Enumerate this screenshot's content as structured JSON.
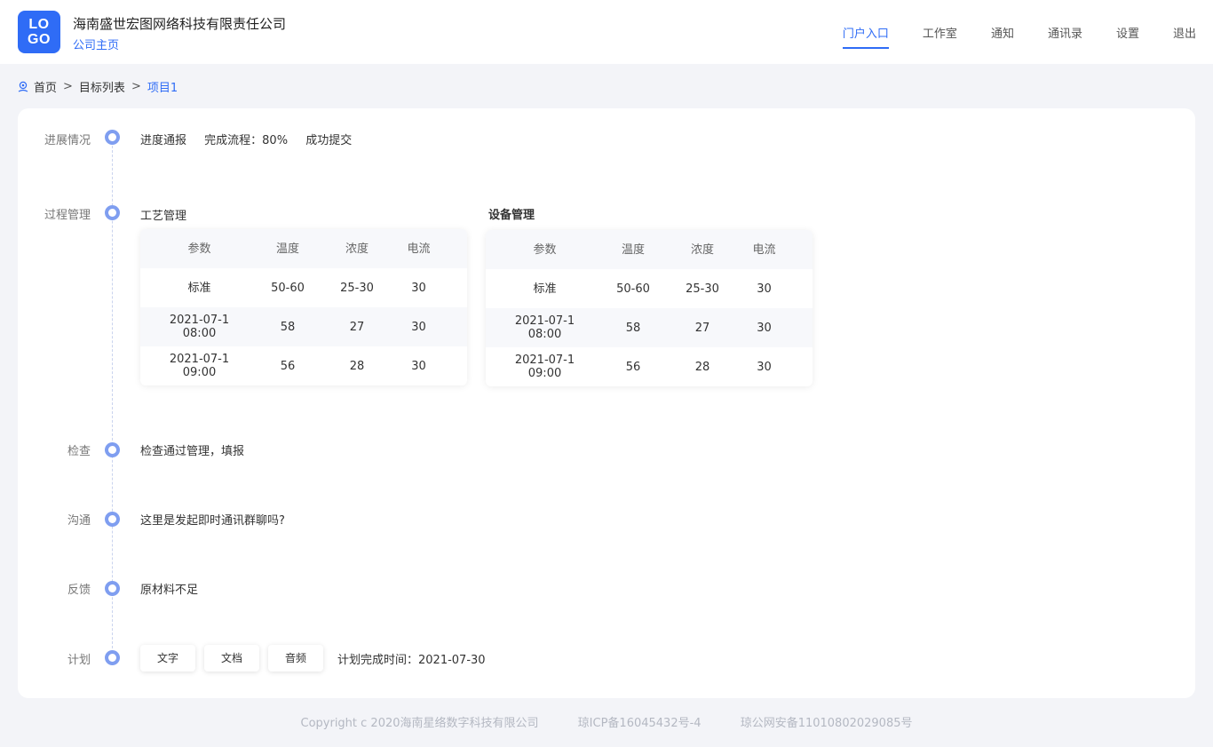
{
  "header": {
    "logo_line1": "LO",
    "logo_line2": "GO",
    "company_name": "海南盛世宏图网络科技有限责任公司",
    "company_home": "公司主页",
    "nav": [
      "门户入口",
      "工作室",
      "通知",
      "通讯录",
      "设置",
      "退出"
    ],
    "active_nav": "门户入口"
  },
  "breadcrumb": {
    "items": [
      "首页",
      "目标列表",
      "项目1"
    ],
    "separator": ">"
  },
  "timeline": {
    "progress": {
      "label": "进展情况",
      "report": "进度通报",
      "completion": "完成流程：80%",
      "status": "成功提交"
    },
    "process": {
      "label": "过程管理",
      "tables": [
        {
          "title": "工艺管理",
          "headers": [
            "参数",
            "温度",
            "浓度",
            "电流"
          ],
          "rows": [
            [
              "标准",
              "50-60",
              "25-30",
              "30"
            ],
            [
              "2021-07-1\n08:00",
              "58",
              "27",
              "30"
            ],
            [
              "2021-07-1\n09:00",
              "56",
              "28",
              "30"
            ]
          ]
        },
        {
          "title": "设备管理",
          "headers": [
            "参数",
            "温度",
            "浓度",
            "电流"
          ],
          "rows": [
            [
              "标准",
              "50-60",
              "25-30",
              "30"
            ],
            [
              "2021-07-1\n08:00",
              "58",
              "27",
              "30"
            ],
            [
              "2021-07-1\n09:00",
              "56",
              "28",
              "30"
            ]
          ]
        }
      ]
    },
    "check": {
      "label": "检查",
      "text": "检查通过管理，填报"
    },
    "communicate": {
      "label": "沟通",
      "text": "这里是发起即时通讯群聊吗?"
    },
    "feedback": {
      "label": "反馈",
      "text": "原材料不足"
    },
    "plan": {
      "label": "计划",
      "buttons": [
        "文字",
        "文档",
        "音频"
      ],
      "time_text": "计划完成时间：2021-07-30"
    }
  },
  "footer": {
    "copyright": "Copyright c 2020海南星络数字科技有限公司",
    "icp": "琼ICP备16045432号-4",
    "police": "琼公网安备11010802029085号"
  },
  "colors": {
    "accent": "#2f6cf6",
    "timeline_dot": "#7f9ef0",
    "background": "#f3f4f8"
  }
}
